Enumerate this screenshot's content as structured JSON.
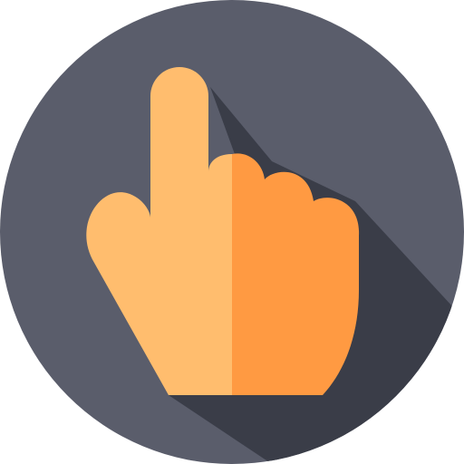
{
  "icon": {
    "name": "pointing-hand-icon",
    "style": "flat long-shadow",
    "colors": {
      "background_circle": "#5A5D6B",
      "long_shadow": "#3A3D48",
      "hand_light": "#FFBD6E",
      "hand_dark": "#FF9A42"
    }
  }
}
